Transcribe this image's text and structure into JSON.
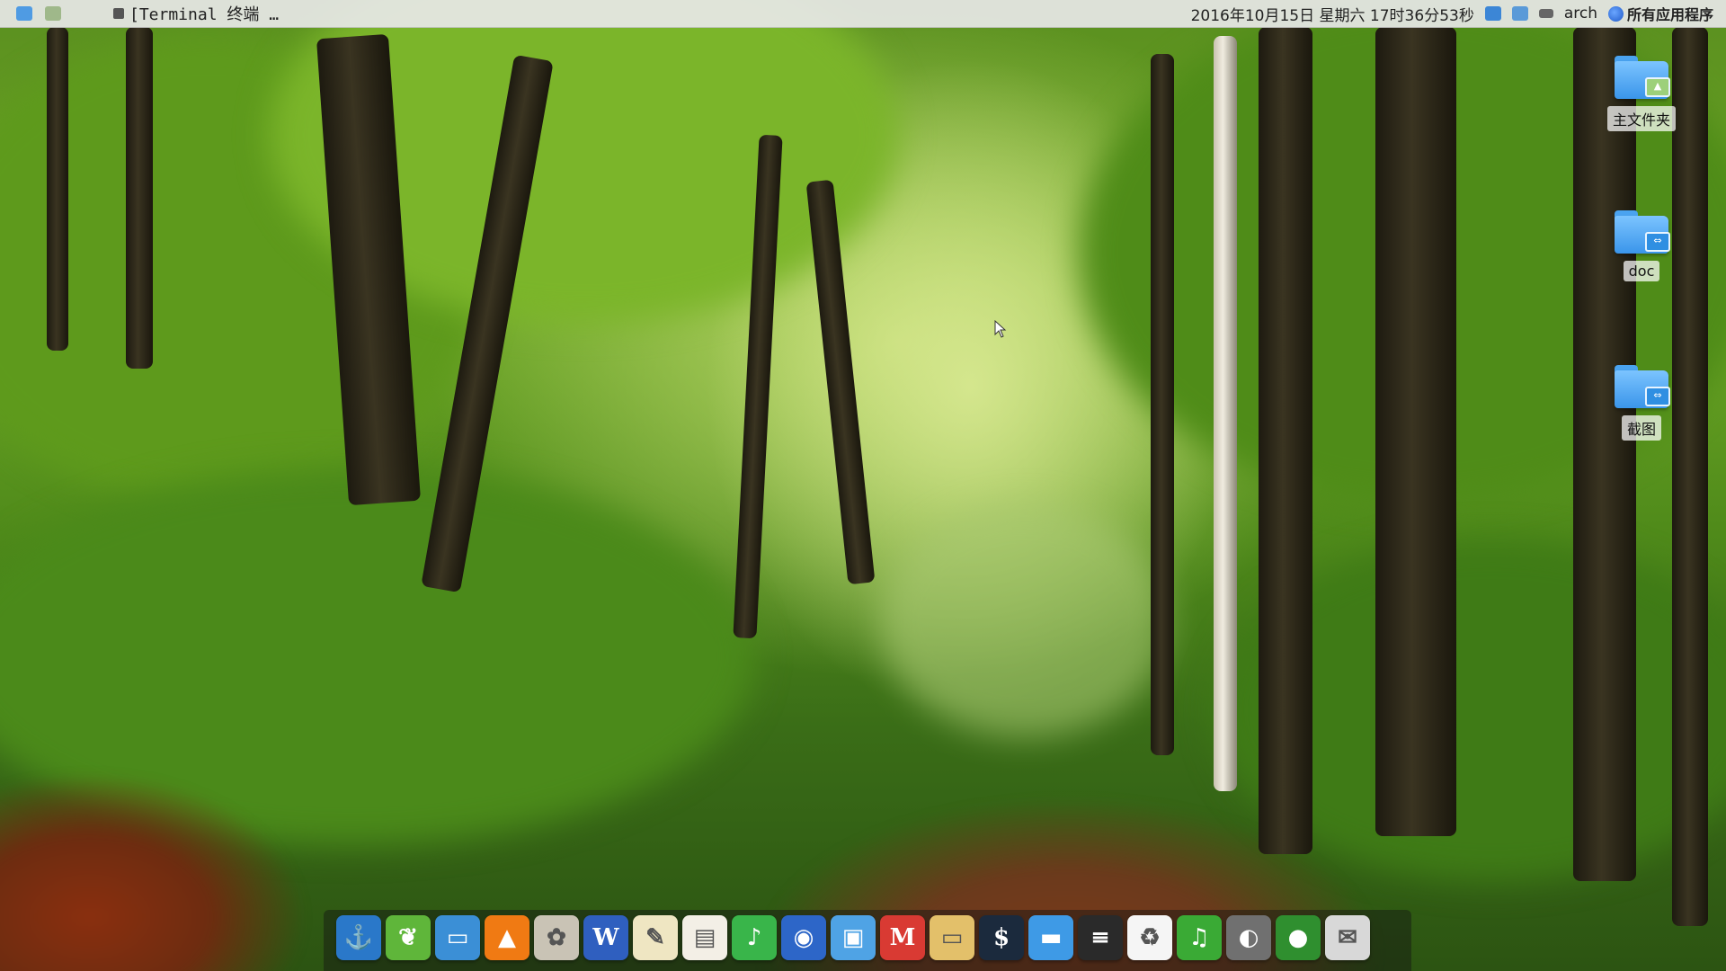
{
  "top_panel": {
    "window_title": "[Terminal 终端 …",
    "datetime": "2016年10月15日  星期六  17时36分53秒",
    "username": "arch",
    "apps_button": "所有应用程序"
  },
  "desktop_icons": [
    {
      "label": "主文件夹",
      "icon": "home-folder-icon"
    },
    {
      "label": "doc",
      "icon": "linked-folder-icon"
    },
    {
      "label": "截图",
      "icon": "linked-folder-icon"
    }
  ],
  "dock": {
    "items": [
      {
        "name": "anchor-launcher-icon",
        "glyph": "⚓",
        "color": "#2a78c9"
      },
      {
        "name": "leaf-app-icon",
        "glyph": "❦",
        "color": "#5fb63a"
      },
      {
        "name": "screen-viewer-icon",
        "glyph": "▭",
        "color": "#3b8fd6"
      },
      {
        "name": "vlc-player-icon",
        "glyph": "▲",
        "color": "#f07a13"
      },
      {
        "name": "paint-palette-icon",
        "glyph": "✿",
        "color": "#c9c3b5"
      },
      {
        "name": "word-processor-icon",
        "glyph": "W",
        "color": "#2f5fbf"
      },
      {
        "name": "text-editor-icon",
        "glyph": "✎",
        "color": "#efe6c2"
      },
      {
        "name": "notes-icon",
        "glyph": "▤",
        "color": "#f3efe6"
      },
      {
        "name": "music-player-icon",
        "glyph": "♪",
        "color": "#39b54a"
      },
      {
        "name": "chat-app-icon",
        "glyph": "◉",
        "color": "#2d66c8"
      },
      {
        "name": "screenshot-tool-icon",
        "glyph": "▣",
        "color": "#4fa3e5"
      },
      {
        "name": "markdown-editor-icon",
        "glyph": "M",
        "color": "#d93a33"
      },
      {
        "name": "file-manager-icon",
        "glyph": "▭",
        "color": "#e3c06a"
      },
      {
        "name": "terminal-icon",
        "glyph": "$",
        "color": "#1b2a3d"
      },
      {
        "name": "display-settings-icon",
        "glyph": "▬",
        "color": "#3e9ae6"
      },
      {
        "name": "system-monitor-icon",
        "glyph": "≡",
        "color": "#2a2a2a"
      },
      {
        "name": "trash-icon",
        "glyph": "♻",
        "color": "#f5f5f5"
      },
      {
        "name": "music-note-icon",
        "glyph": "♫",
        "color": "#3aaa35"
      },
      {
        "name": "settings-tool-icon",
        "glyph": "◐",
        "color": "#707070"
      },
      {
        "name": "green-ball-app-icon",
        "glyph": "●",
        "color": "#2f8f2f"
      },
      {
        "name": "mail-icon",
        "glyph": "✉",
        "color": "#d8d8d8"
      }
    ]
  }
}
